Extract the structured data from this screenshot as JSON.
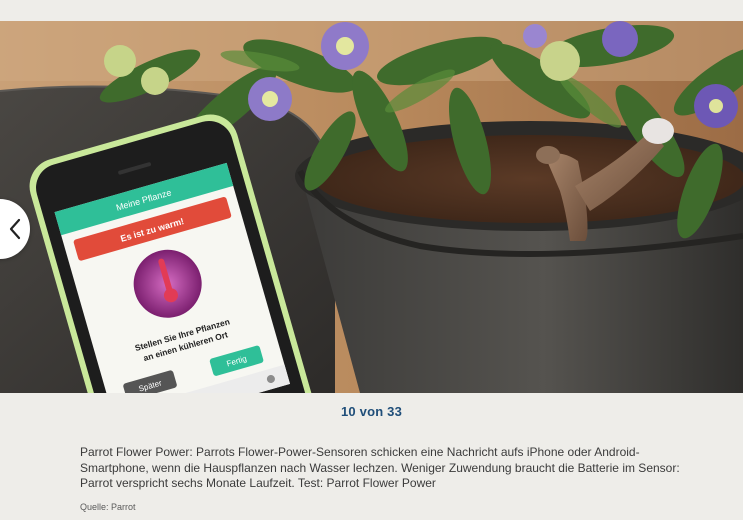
{
  "gallery": {
    "counter_text": "10 von 33",
    "caption": "Parrot Flower Power: Parrots Flower-Power-Sensoren schicken eine Nachricht aufs iPhone oder Android-Smartphone, wenn die Hauspflanzen nach Wasser lechzen. Weniger Zuwendung braucht die Batterie im Sensor: Parrot verspricht sechs Monate Laufzeit. Test: Parrot Flower Power",
    "source": "Quelle: Parrot",
    "prev_icon": "chevron-left-icon"
  },
  "phone_screen": {
    "header_title": "Meine Pflanze",
    "alert_title": "Es ist zu warm!",
    "message": [
      "Stellen Sie Ihre Pflanzen",
      "an einen kühleren Ort"
    ],
    "later_button": "Später",
    "done_button": "Fertig"
  },
  "colors": {
    "page_bg": "#eeede9",
    "counter": "#1f4e79",
    "phone_accent": "#2fbf98",
    "alert_red": "#e14b3a"
  }
}
